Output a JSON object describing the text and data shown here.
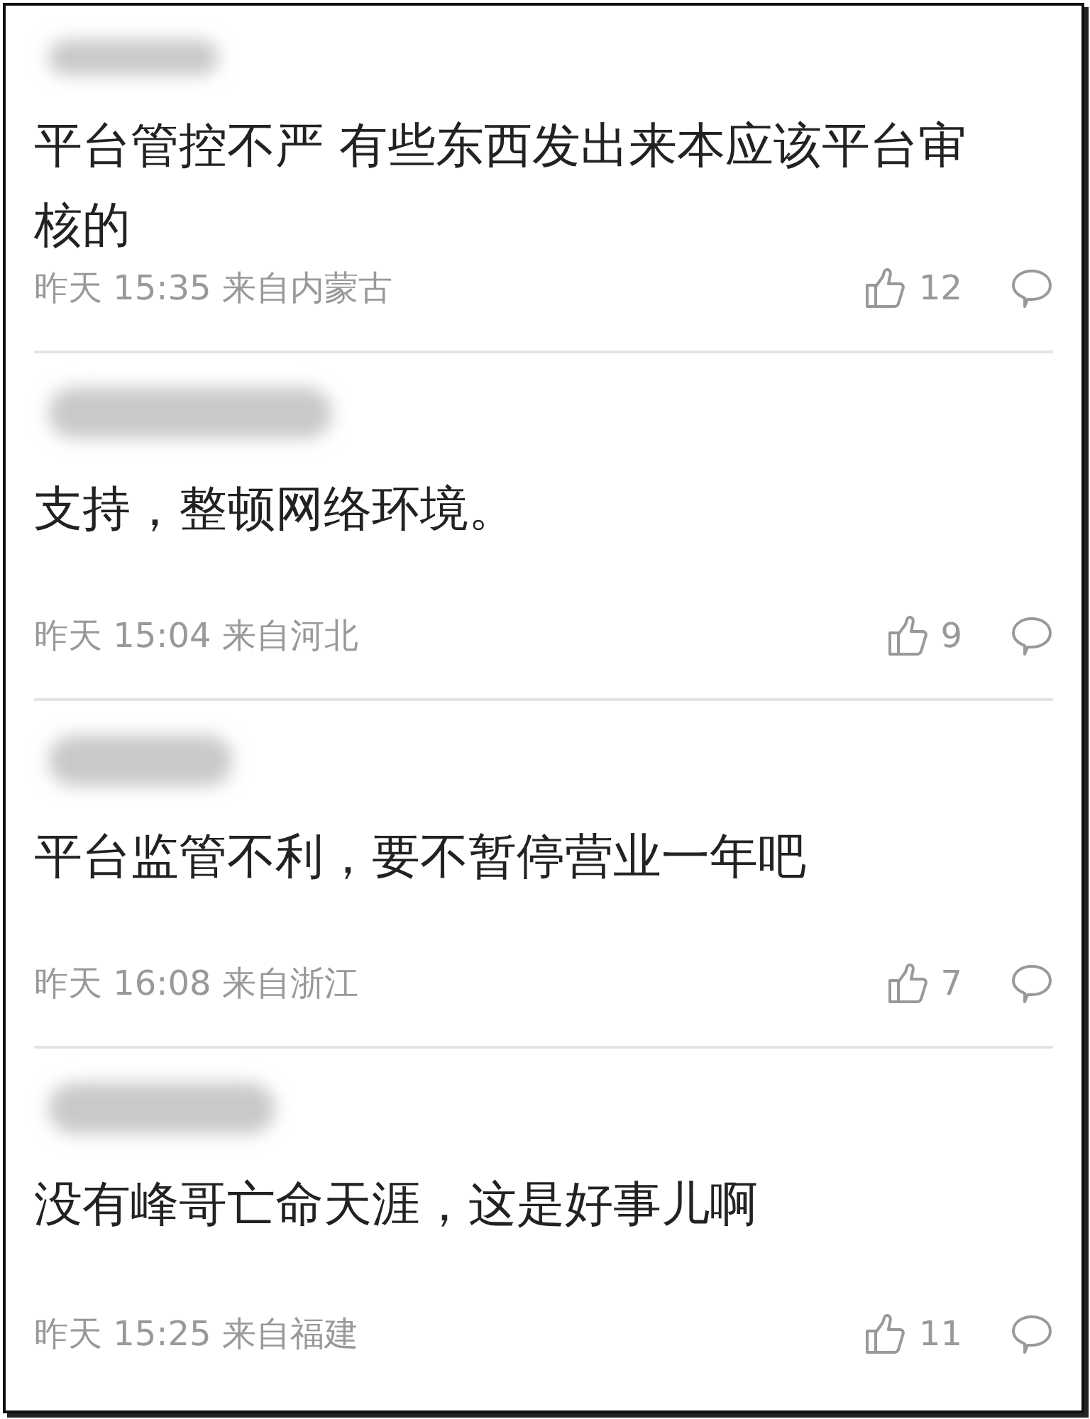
{
  "comments": [
    {
      "text": "平台管控不严 有些东西发出来本应该平台审核的",
      "time": "昨天 15:35 来自内蒙古",
      "likes": "12"
    },
    {
      "text": "支持，整顿网络环境。",
      "time": "昨天 15:04 来自河北",
      "likes": "9"
    },
    {
      "text": "平台监管不利，要不暂停营业一年吧",
      "time": "昨天 16:08 来自浙江",
      "likes": "7"
    },
    {
      "text": "没有峰哥亡命天涯，这是好事儿啊",
      "time": "昨天 15:25 来自福建",
      "likes": "11"
    }
  ]
}
